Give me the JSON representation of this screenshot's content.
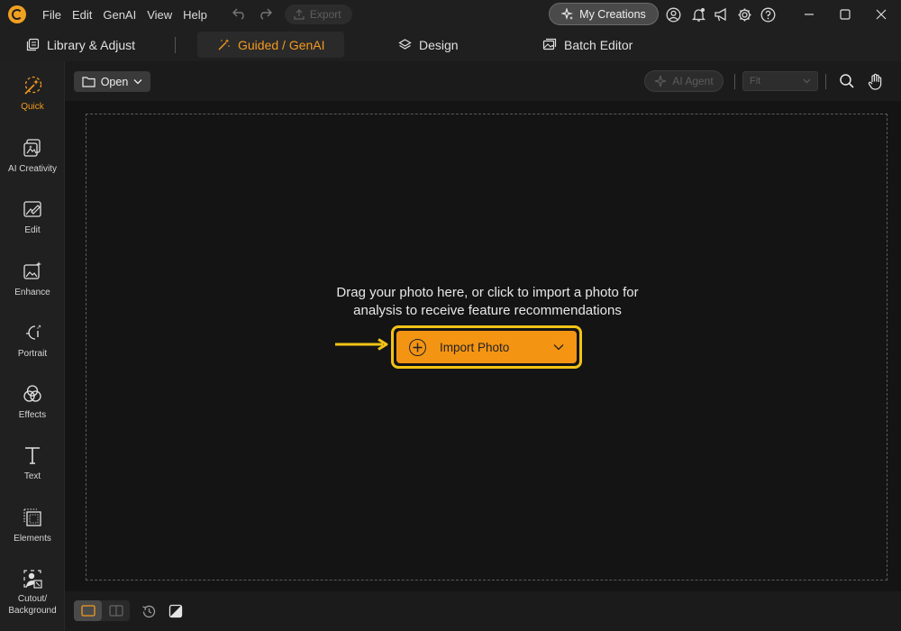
{
  "menu": [
    "File",
    "Edit",
    "GenAI",
    "View",
    "Help"
  ],
  "titlebar": {
    "export_label": "Export",
    "my_creations_label": "My Creations"
  },
  "mode_tabs": {
    "library": "Library & Adjust",
    "guided": "Guided / GenAI",
    "design": "Design",
    "batch": "Batch Editor"
  },
  "sidebar": {
    "items": [
      {
        "label": "Quick",
        "icon": "magic-wand-icon"
      },
      {
        "label": "AI Creativity",
        "icon": "ai-creativity-icon"
      },
      {
        "label": "Edit",
        "icon": "edit-image-icon"
      },
      {
        "label": "Enhance",
        "icon": "enhance-image-icon"
      },
      {
        "label": "Portrait",
        "icon": "portrait-icon"
      },
      {
        "label": "Effects",
        "icon": "effects-icon"
      },
      {
        "label": "Text",
        "icon": "text-icon"
      },
      {
        "label": "Elements",
        "icon": "elements-icon"
      },
      {
        "label": "Cutout/",
        "label2": "Background",
        "icon": "cutout-icon"
      }
    ]
  },
  "toolbar": {
    "open_label": "Open",
    "ai_agent_label": "AI Agent",
    "zoom_value": "Fit"
  },
  "canvas": {
    "drop_line1": "Drag your photo here, or click to import a photo for",
    "drop_line2": "analysis to receive feature recommendations",
    "import_label": "Import Photo"
  },
  "colors": {
    "accent": "#f39a1f",
    "import_button": "#f49413",
    "highlight": "#f2c316"
  }
}
